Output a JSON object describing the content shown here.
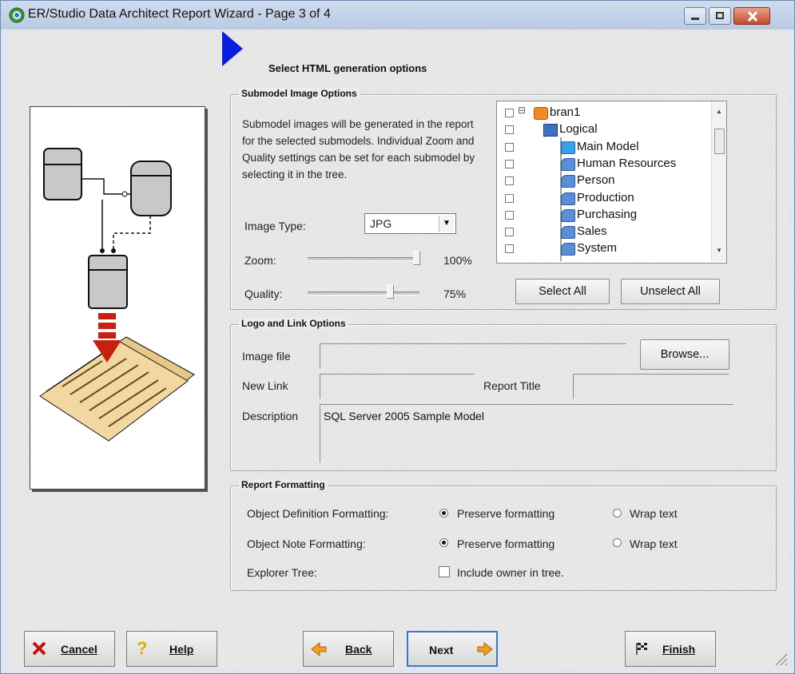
{
  "window": {
    "title": "ER/Studio Data Architect Report Wizard - Page 3 of 4",
    "controls": [
      "minimize",
      "maximize",
      "close"
    ]
  },
  "header": {
    "heading": "Select HTML generation options"
  },
  "submodel": {
    "legend": "Submodel Image Options",
    "description": "Submodel images will be generated in the report for the selected submodels. Individual Zoom and Quality settings can be set for each submodel  by selecting it in the tree.",
    "image_type_label": "Image Type:",
    "image_type_value": "JPG",
    "zoom_label": "Zoom:",
    "zoom_value": "100%",
    "zoom_fraction": 1.0,
    "quality_label": "Quality:",
    "quality_value": "75%",
    "quality_fraction": 0.75,
    "tree": [
      {
        "label": "bran1",
        "level": 0,
        "icon": "database-icon",
        "checked": false
      },
      {
        "label": "Logical",
        "level": 1,
        "icon": "model-icon",
        "checked": false
      },
      {
        "label": "Main Model",
        "level": 2,
        "icon": "folder-icon",
        "checked": false
      },
      {
        "label": "Human Resources",
        "level": 2,
        "icon": "submodel-icon",
        "checked": false
      },
      {
        "label": "Person",
        "level": 2,
        "icon": "submodel-icon",
        "checked": false
      },
      {
        "label": "Production",
        "level": 2,
        "icon": "submodel-icon",
        "checked": false
      },
      {
        "label": "Purchasing",
        "level": 2,
        "icon": "submodel-icon",
        "checked": false
      },
      {
        "label": "Sales",
        "level": 2,
        "icon": "submodel-icon",
        "checked": false
      },
      {
        "label": "System",
        "level": 2,
        "icon": "submodel-icon",
        "checked": false
      }
    ],
    "select_all": "Select All",
    "unselect_all": "Unselect All"
  },
  "logo": {
    "legend": "Logo and Link Options",
    "image_file_label": "Image file",
    "image_file_value": "",
    "browse": "Browse...",
    "new_link_label": "New Link",
    "new_link_value": "",
    "report_title_label": "Report Title",
    "report_title_value": "",
    "description_label": "Description",
    "description_value": "SQL Server 2005 Sample Model"
  },
  "formatting": {
    "legend": "Report Formatting",
    "def_label": "Object Definition Formatting:",
    "note_label": "Object Note Formatting:",
    "preserve": "Preserve formatting",
    "wrap": "Wrap text",
    "def_selected": "preserve",
    "note_selected": "preserve",
    "tree_label": "Explorer Tree:",
    "include_owner": "Include owner in tree.",
    "include_owner_checked": false
  },
  "footer": {
    "cancel": "Cancel",
    "help": "Help",
    "back": "Back",
    "next": "Next",
    "finish": "Finish"
  }
}
